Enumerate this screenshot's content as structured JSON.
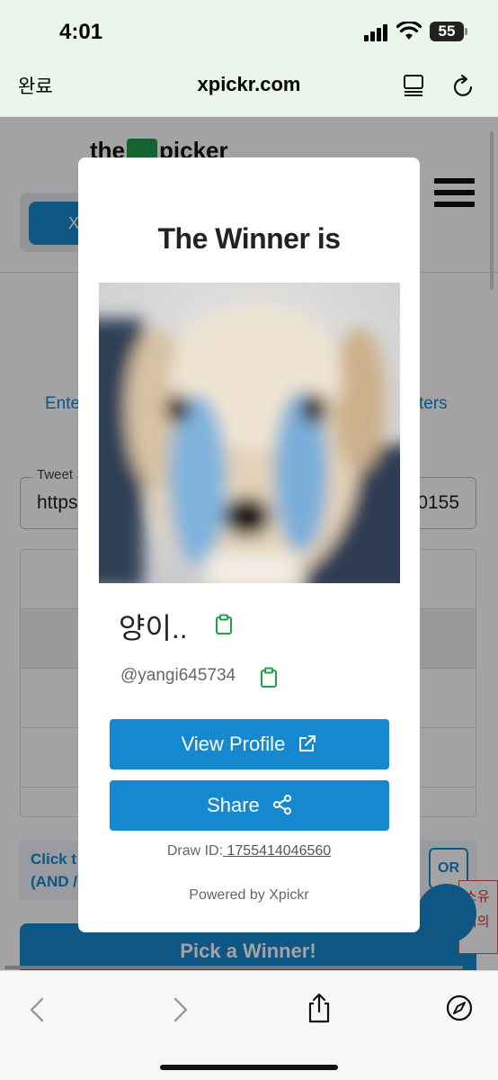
{
  "status_bar": {
    "time": "4:01",
    "battery": "55",
    "icons": [
      "cellular-signal-icon",
      "wifi-icon",
      "battery-icon"
    ]
  },
  "browser": {
    "done_label": "완료",
    "url": "xpickr.com",
    "icons": [
      "reader-mode-icon",
      "reload-icon",
      "back-arrow-icon",
      "forward-arrow-icon",
      "share-icon",
      "compass-icon"
    ]
  },
  "background_page": {
    "logo_left": "the",
    "logo_right": "picker",
    "tab_label": "X",
    "enter_left": "Ente",
    "enter_right": "ters",
    "tweet_label": "Tweet",
    "tweet_value_left": "https",
    "tweet_value_right": "0155",
    "click_text_line1": "Click t",
    "click_text_line2": "(AND /",
    "or_label": "OR",
    "pick_winner_label": "Pick a Winner!",
    "side_ad_line1": "소유",
    "side_ad_line2": "키의"
  },
  "modal": {
    "title": "The Winner is",
    "winner_name": "양이..",
    "winner_handle": "@yangi645734",
    "view_profile_label": "View Profile",
    "share_label": "Share",
    "draw_id_label": "Draw ID:",
    "draw_id_value": " 1755414046560",
    "powered_by": "Powered by Xpickr"
  },
  "colors": {
    "accent": "#1688d0",
    "brand_green": "#1f9d4a",
    "copy_icon": "#1fa34a",
    "browser_bar": "#eaf5ec"
  }
}
